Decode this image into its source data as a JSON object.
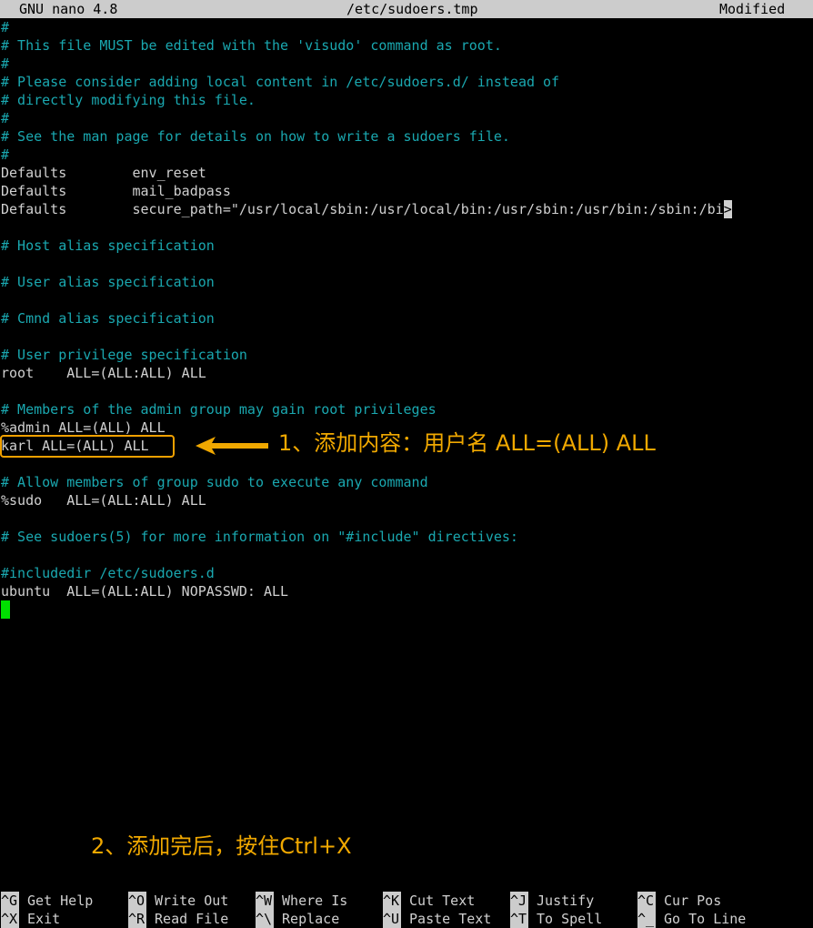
{
  "titlebar": {
    "app": "GNU nano 4.8",
    "filename": "/etc/sudoers.tmp",
    "status": "Modified"
  },
  "lines": [
    {
      "text": "#",
      "kind": "comment"
    },
    {
      "text": "# This file MUST be edited with the 'visudo' command as root.",
      "kind": "comment"
    },
    {
      "text": "#",
      "kind": "comment"
    },
    {
      "text": "# Please consider adding local content in /etc/sudoers.d/ instead of",
      "kind": "comment"
    },
    {
      "text": "# directly modifying this file.",
      "kind": "comment"
    },
    {
      "text": "#",
      "kind": "comment"
    },
    {
      "text": "# See the man page for details on how to write a sudoers file.",
      "kind": "comment"
    },
    {
      "text": "#",
      "kind": "comment"
    },
    {
      "text": "Defaults        env_reset",
      "kind": "text"
    },
    {
      "text": "Defaults        mail_badpass",
      "kind": "text"
    },
    {
      "text": "Defaults        secure_path=\"/usr/local/sbin:/usr/local/bin:/usr/sbin:/usr/bin:/sbin:/bi",
      "kind": "text"
    },
    {
      "text": "",
      "kind": "text"
    },
    {
      "text": "# Host alias specification",
      "kind": "comment"
    },
    {
      "text": "",
      "kind": "text"
    },
    {
      "text": "# User alias specification",
      "kind": "comment"
    },
    {
      "text": "",
      "kind": "text"
    },
    {
      "text": "# Cmnd alias specification",
      "kind": "comment"
    },
    {
      "text": "",
      "kind": "text"
    },
    {
      "text": "# User privilege specification",
      "kind": "comment"
    },
    {
      "text": "root    ALL=(ALL:ALL) ALL",
      "kind": "text"
    },
    {
      "text": "",
      "kind": "text"
    },
    {
      "text": "# Members of the admin group may gain root privileges",
      "kind": "comment"
    },
    {
      "text": "%admin ALL=(ALL) ALL",
      "kind": "text"
    },
    {
      "text": "karl ALL=(ALL) ALL",
      "kind": "text"
    },
    {
      "text": "",
      "kind": "text"
    },
    {
      "text": "# Allow members of group sudo to execute any command",
      "kind": "comment"
    },
    {
      "text": "%sudo   ALL=(ALL:ALL) ALL",
      "kind": "text"
    },
    {
      "text": "",
      "kind": "text"
    },
    {
      "text": "# See sudoers(5) for more information on \"#include\" directives:",
      "kind": "comment"
    },
    {
      "text": "",
      "kind": "text"
    },
    {
      "text": "#includedir /etc/sudoers.d",
      "kind": "comment"
    },
    {
      "text": "ubuntu  ALL=(ALL:ALL) NOPASSWD: ALL",
      "kind": "text"
    }
  ],
  "continuation_marker": ">",
  "annotations": {
    "step1": "1、添加内容：用户名 ALL=(ALL) ALL",
    "step2": "2、添加完后，按住Ctrl+X",
    "highlight_color": "#f0a000"
  },
  "shortcuts": {
    "row1": [
      {
        "key": "^G",
        "label": "Get Help"
      },
      {
        "key": "^O",
        "label": "Write Out"
      },
      {
        "key": "^W",
        "label": "Where Is"
      },
      {
        "key": "^K",
        "label": "Cut Text"
      },
      {
        "key": "^J",
        "label": "Justify"
      },
      {
        "key": "^C",
        "label": "Cur Pos"
      }
    ],
    "row2": [
      {
        "key": "^X",
        "label": "Exit"
      },
      {
        "key": "^R",
        "label": "Read File"
      },
      {
        "key": "^\\",
        "label": "Replace"
      },
      {
        "key": "^U",
        "label": "Paste Text"
      },
      {
        "key": "^T",
        "label": "To Spell"
      },
      {
        "key": "^_",
        "label": "Go To Line"
      }
    ]
  },
  "colors": {
    "comment": "#1aa8b0",
    "text": "#d0d0d0",
    "cursor": "#00e000",
    "annotation": "#f0a800"
  }
}
